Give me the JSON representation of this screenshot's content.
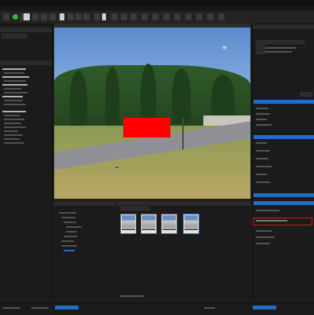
{
  "colors": {
    "accent_blue": "#1f6fc9",
    "sign_red": "#ff0000",
    "highlight_red": "#e01010",
    "bg_dark": "#1b1b1b"
  },
  "toolbar": {
    "icons": [
      "play-icon",
      "select-icon",
      "move-icon",
      "rotate-icon",
      "scale-icon",
      "snap-icon",
      "camera-icon",
      "grid-icon"
    ]
  },
  "viewport": {
    "scene_object": "red sign",
    "compass_glyph": "✳"
  }
}
